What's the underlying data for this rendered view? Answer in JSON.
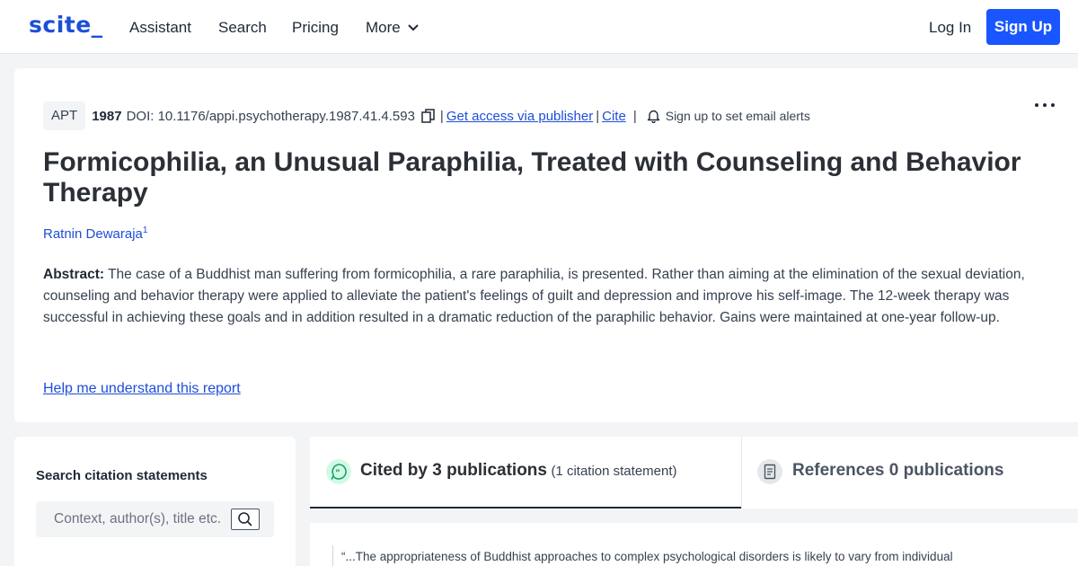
{
  "header": {
    "logo": "scite_",
    "nav": [
      "Assistant",
      "Search",
      "Pricing",
      "More"
    ],
    "login": "Log In",
    "signup": "Sign Up"
  },
  "paper": {
    "journal": "APT",
    "year": "1987",
    "doi": "DOI: 10.1176/appi.psychotherapy.1987.41.4.593",
    "sep": "|",
    "access_link": "Get access via publisher",
    "cite_link": "Cite",
    "alerts": "Sign up to set email alerts",
    "title": "Formicophilia, an Unusual Paraphilia, Treated with Counseling and Behavior Therapy",
    "author": "Ratnin Dewaraja",
    "author_sup": "1",
    "abstract_label": "Abstract:",
    "abstract": " The case of a Buddhist man suffering from formicophilia, a rare paraphilia, is presented. Rather than aiming at the elimination of the sexual deviation, counseling and behavior therapy were applied to alleviate the patient's feelings of guilt and depression and improve his self-image. The 12-week therapy was successful in achieving these goals and in addition resulted in a dramatic reduction of the paraphilic behavior. Gains were maintained at one-year follow-up.",
    "help_link": "Help me understand this report"
  },
  "sidebar": {
    "title": "Search citation statements",
    "placeholder": "Context, author(s), title etc."
  },
  "tabs": {
    "cited_label": "Cited by 3 publications",
    "cited_sub": "(1 citation statement)",
    "refs_label": "References 0 publications"
  },
  "citation": {
    "quote": "“...The appropriateness of Buddhist approaches to complex psychological disorders is likely to vary from individual"
  },
  "colors": {
    "brand": "#1d4ed8",
    "signup_bg": "#1a56ff",
    "cited_icon": "#22a06b"
  },
  "icons": [
    "chevron-down-icon",
    "copy-icon",
    "bell-icon",
    "more-options-icon",
    "search-icon",
    "chat-quote-icon",
    "document-icon"
  ]
}
